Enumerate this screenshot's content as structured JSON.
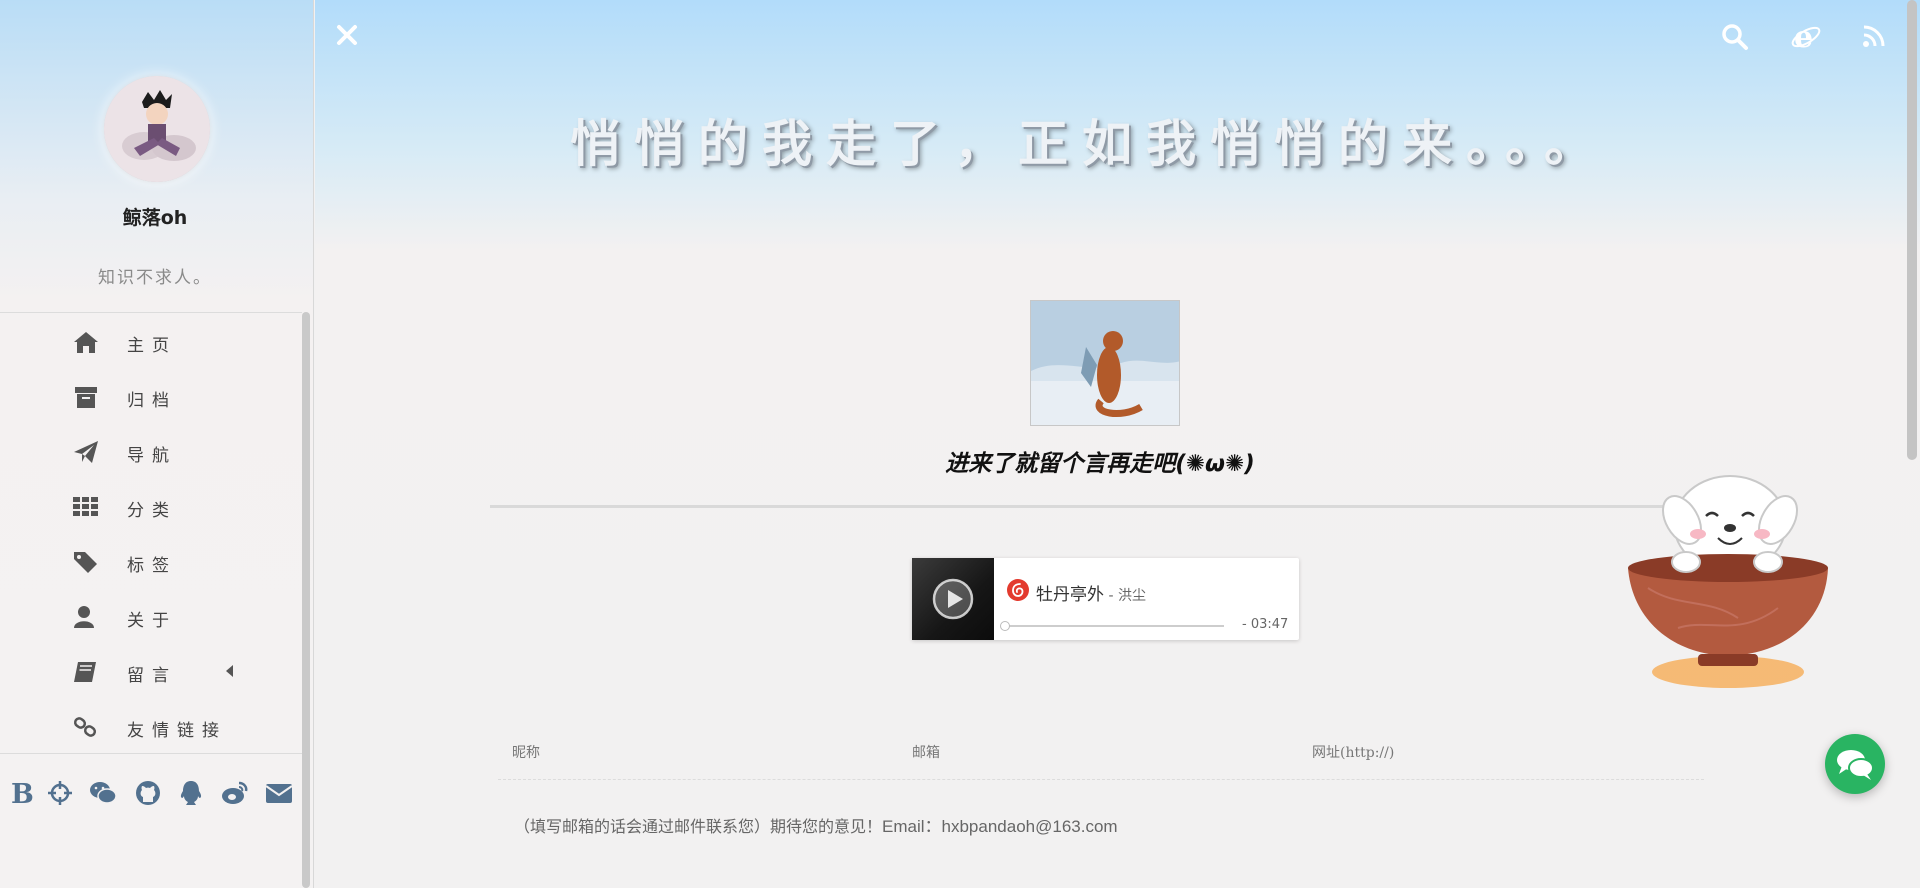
{
  "sidebar": {
    "author": "鲸落oh",
    "motto": "知识不求人。",
    "menu": [
      {
        "label": "主页",
        "icon": "home-icon"
      },
      {
        "label": "归档",
        "icon": "archive-icon"
      },
      {
        "label": "导航",
        "icon": "paper-plane-icon"
      },
      {
        "label": "分类",
        "icon": "grid-icon"
      },
      {
        "label": "标签",
        "icon": "tags-icon"
      },
      {
        "label": "关于",
        "icon": "user-icon"
      },
      {
        "label": "留言",
        "icon": "book-icon"
      },
      {
        "label": "友情链接",
        "icon": "link-icon"
      }
    ],
    "social": [
      "bilibili-icon",
      "crosshair-icon",
      "wechat-icon",
      "github-icon",
      "qq-icon",
      "weibo-icon",
      "mail-icon"
    ]
  },
  "header": {
    "headline": "悄悄的我走了，正如我悄悄的来。。。",
    "icons": [
      "close-icon",
      "search-icon",
      "ie-icon",
      "rss-icon"
    ]
  },
  "main": {
    "invite": "进来了就留个言再走吧(✺ω✺)",
    "player": {
      "title": "牡丹亭外",
      "artist": " - 洪尘",
      "time": "- 03:47"
    },
    "form": {
      "nickname": "昵称",
      "email": "邮箱",
      "website": "网址(http://)",
      "notice": "（填写邮箱的话会通过邮件联系您）期待您的意见！",
      "notice_email": "Email：hxbpandaoh@163.com"
    }
  },
  "colors": {
    "accent": "#29b462",
    "netease_red": "#e33a2e",
    "sky_top": "#b2dcfa"
  }
}
